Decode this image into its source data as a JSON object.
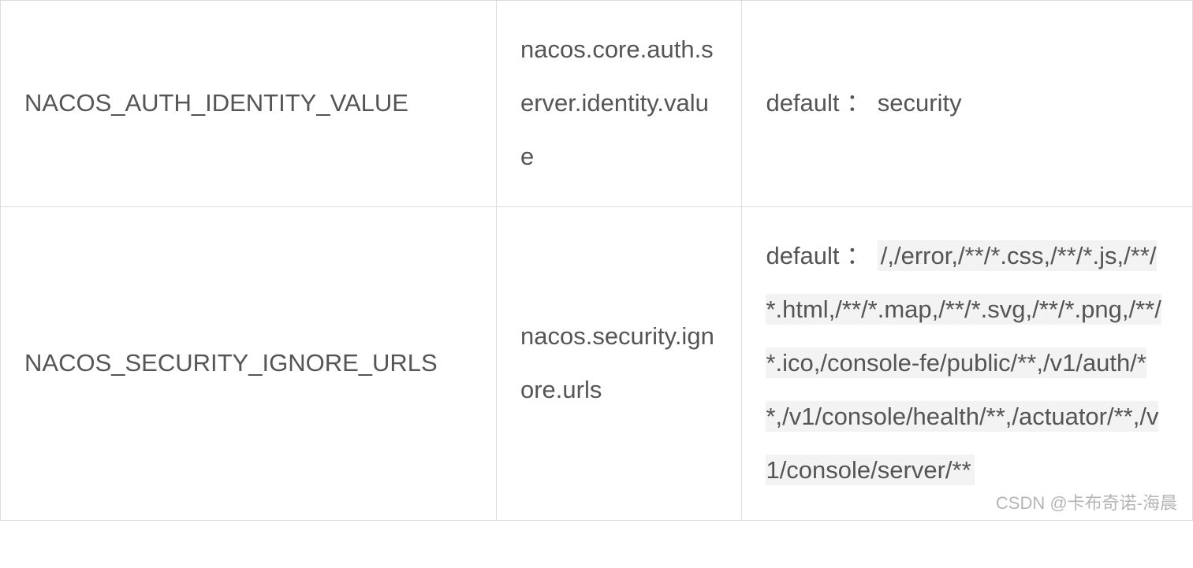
{
  "table": {
    "rows": [
      {
        "name": "NACOS_AUTH_IDENTITY_VALUE",
        "property": "nacos.core.auth.server.identity.value",
        "desc_prefix": "default ：",
        "desc_code": "",
        "desc_plain": "security"
      },
      {
        "name": "NACOS_SECURITY_IGNORE_URLS",
        "property": "nacos.security.ignore.urls",
        "desc_prefix": "default ：",
        "desc_code": "/,/error,/**/*.css,/**/*.js,/**/*.html,/**/*.map,/**/*.svg,/**/*.png,/**/*.ico,/console-fe/public/**,/v1/auth/**,/v1/console/health/**,/actuator/**,/v1/console/server/**",
        "desc_plain": ""
      }
    ]
  },
  "watermark": "CSDN @卡布奇诺-海晨"
}
